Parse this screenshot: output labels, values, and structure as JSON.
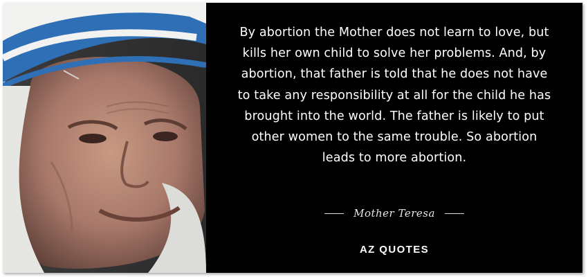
{
  "quote": {
    "text": "By abortion the Mother does not learn to love, but kills her own child to solve her problems. And, by abortion, that father is told that he does not have to take any responsibility at all for the child he has brought into the world. The father is likely to put other women to the same trouble. So abortion leads to more abortion.",
    "author": "Mother Teresa"
  },
  "brand": {
    "name": "AZ QUOTES"
  },
  "colors": {
    "panel_background": "#000000",
    "text": "#ffffff",
    "veil_white": "#f2f2f0",
    "veil_blue": "#2f6fb6"
  }
}
